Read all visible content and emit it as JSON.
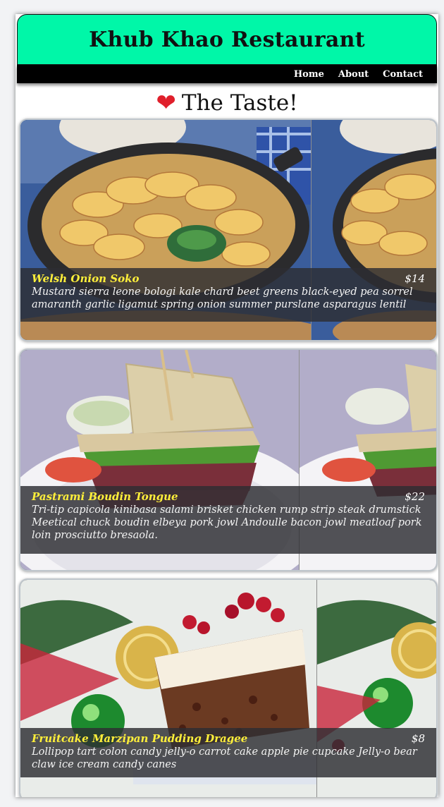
{
  "app": {
    "title": "Khub Khao Restaurant",
    "tagline": "The Taste!"
  },
  "nav": {
    "items": [
      {
        "label": "Home"
      },
      {
        "label": "About"
      },
      {
        "label": "Contact"
      }
    ]
  },
  "menu": [
    {
      "name": "Welsh Onion Soko",
      "price": "$14",
      "description": "Mustard sierra leone bologi kale chard beet greens black-eyed pea sorrel amaranth garlic ligamut spring onion summer purslane asparagus lentil",
      "image": "potato-gratin-skillet"
    },
    {
      "name": "Pastrami Boudin Tongue",
      "price": "$22",
      "description": "Tri-tip capicola kinibasa salami brisket chicken rump strip steak drumstick Meetical chuck boudin elbeya pork jowl Andoulle bacon jowl meatloaf pork loin prosciutto bresaola.",
      "image": "pastrami-sandwich"
    },
    {
      "name": "Fruitcake Marzipan Pudding Dragee",
      "price": "$8",
      "description": "Lollipop tart colon candy jelly-o carrot cake apple pie cupcake Jelly-o bear claw ice cream candy canes",
      "image": "christmas-fruitcake"
    }
  ],
  "colors": {
    "header_bg": "#00f7a8",
    "nav_bg": "#000000",
    "dish_name": "#ffef3a",
    "heart": "#e01f2b"
  }
}
